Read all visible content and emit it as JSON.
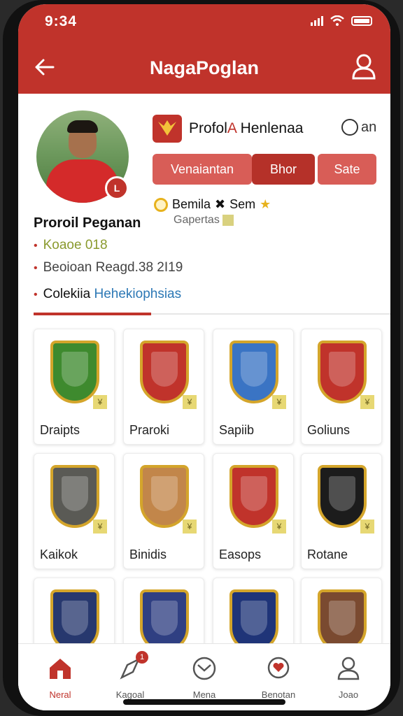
{
  "status": {
    "time": "9:34"
  },
  "header": {
    "title": "NagaPoglan"
  },
  "profile": {
    "name": "Proroil Peganan",
    "avatar_badge": "L",
    "meta": [
      {
        "text": "Koaoe 018"
      },
      {
        "text": "Beoioan Reagd.38 2I19"
      },
      {
        "text_prefix": "Colekiia",
        "text_link": "Hehekiophsias"
      }
    ]
  },
  "brand": {
    "title_prefix": "Profol",
    "title_accent": "A",
    "title_suffix": "Henlenaa",
    "chat_label": "an"
  },
  "buttons": [
    {
      "label": "Venaiantan"
    },
    {
      "label": "Bhor"
    },
    {
      "label": "Sate"
    }
  ],
  "rank": {
    "name": "Bemila",
    "suffix": "Sem",
    "sub": "Gapertas"
  },
  "items": [
    {
      "label": "Draipts",
      "color": "#3e8a2e"
    },
    {
      "label": "Praroki",
      "color": "#c0332b"
    },
    {
      "label": "Sapiib",
      "color": "#3a74c4"
    },
    {
      "label": "Goliuns",
      "color": "#c0332b"
    },
    {
      "label": "Kaikok",
      "color": "#5a5a55"
    },
    {
      "label": "Binidis",
      "color": "#c2864a"
    },
    {
      "label": "Easops",
      "color": "#c0332b"
    },
    {
      "label": "Rotane",
      "color": "#1c1c1c"
    },
    {
      "label": "",
      "color": "#27386e"
    },
    {
      "label": "",
      "color": "#2f3f82"
    },
    {
      "label": "",
      "color": "#1f3478"
    },
    {
      "label": "",
      "color": "#7a4a30"
    }
  ],
  "tabbar": [
    {
      "label": "Neral",
      "active": true
    },
    {
      "label": "Kagoal",
      "badge": "1"
    },
    {
      "label": "Mena"
    },
    {
      "label": "Benotan"
    },
    {
      "label": "Joao"
    }
  ]
}
